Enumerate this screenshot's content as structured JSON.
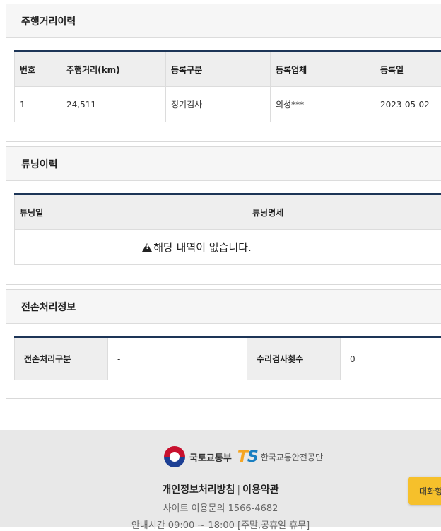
{
  "mileage": {
    "title": "주행거리이력",
    "headers": [
      "번호",
      "주행거리(km)",
      "등록구분",
      "등록업체",
      "등록일"
    ],
    "rows": [
      [
        "1",
        "24,511",
        "정기검사",
        "의성***",
        "2023-05-02"
      ]
    ]
  },
  "tuning": {
    "title": "튜닝이력",
    "headers": [
      "튜닝일",
      "튜닝명세"
    ],
    "empty_message": "해당 내역이 없습니다."
  },
  "total_loss": {
    "title": "전손처리정보",
    "label1": "전손처리구분",
    "value1": "-",
    "label2": "수리검사횟수",
    "value2": "0"
  },
  "footer": {
    "ministry": "국토교통부",
    "ts_name": "한국교통안전공단",
    "privacy_link": "개인정보처리방침",
    "separator": "|",
    "terms_link": "이용약관",
    "phone": "사이트 이용문의 1566-4682",
    "hours": "안내시간 09:00 ~ 18:00 [주말,공휴일 휴무]"
  },
  "chat_button": "대화형"
}
